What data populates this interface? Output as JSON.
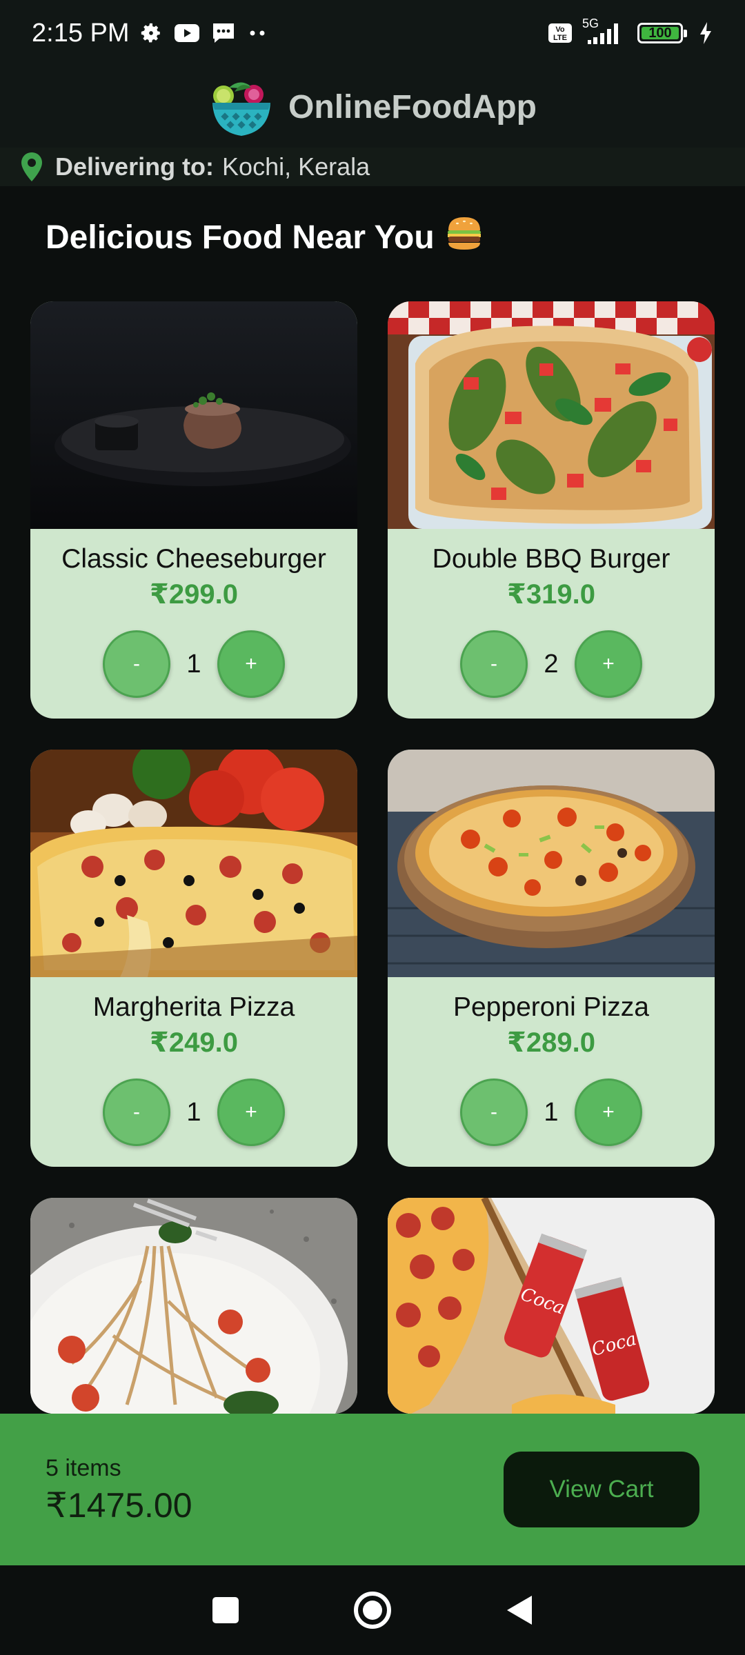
{
  "status_bar": {
    "time": "2:15 PM",
    "network": "5G",
    "battery_level": "100",
    "icons": [
      "settings-icon",
      "youtube-icon",
      "message-icon",
      "more-dots-icon",
      "volte-icon",
      "signal-icon",
      "battery-icon",
      "charging-icon"
    ],
    "volte_label": "Vo\nLTE"
  },
  "header": {
    "title": "OnlineFoodApp",
    "logo": "salad-bowl-logo"
  },
  "location": {
    "label": "Delivering to:",
    "value": "Kochi, Kerala",
    "icon": "location-pin-icon"
  },
  "section_title": "Delicious Food Near You",
  "section_emoji": "🍔",
  "items": [
    {
      "name": "Classic Cheeseburger",
      "price": "₹299.0",
      "qty": "1",
      "image": "steak-plate"
    },
    {
      "name": "Double BBQ Burger",
      "price": "₹319.0",
      "qty": "2",
      "image": "flatbread-pizza"
    },
    {
      "name": "Margherita Pizza",
      "price": "₹249.0",
      "qty": "1",
      "image": "pizza-slice"
    },
    {
      "name": "Pepperoni Pizza",
      "price": "₹289.0",
      "qty": "1",
      "image": "pizza-board"
    },
    {
      "name": "",
      "price": "",
      "qty": "",
      "image": "spaghetti"
    },
    {
      "name": "",
      "price": "",
      "qty": "",
      "image": "pizza-cola"
    }
  ],
  "stepper": {
    "minus": "-",
    "plus": "+"
  },
  "cart": {
    "count": "5 items",
    "total": "₹1475.00",
    "button": "View Cart"
  },
  "colors": {
    "accent": "#43a047",
    "card_bg": "#cfe7cd",
    "price": "#3d9b42",
    "background": "#0c0f0e"
  },
  "nav": [
    "recents-button",
    "home-button",
    "back-button"
  ]
}
